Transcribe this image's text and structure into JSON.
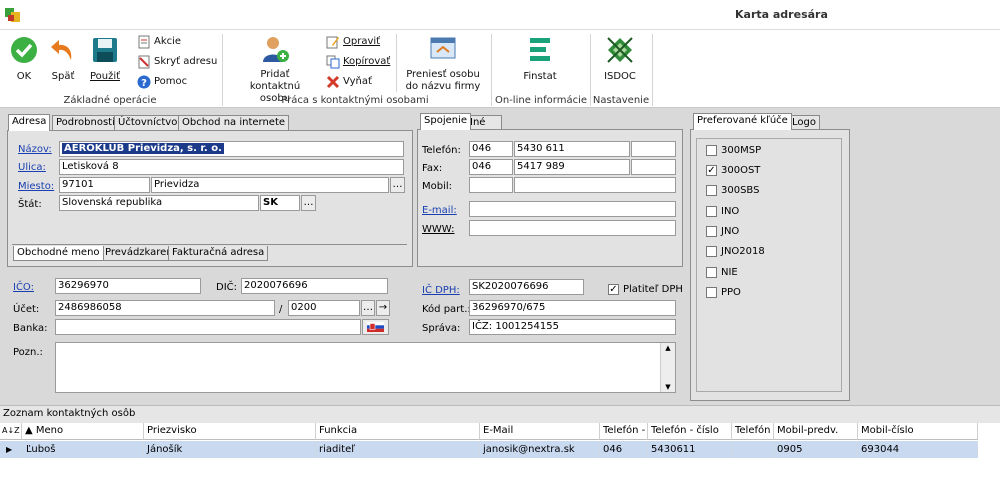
{
  "window": {
    "title": "Karta adresára"
  },
  "ribbon": {
    "ok": "OK",
    "back": "Späť",
    "use": "Použiť",
    "akcie": "Akcie",
    "skryt": "Skryť adresu",
    "pomoc": "Pomoc",
    "group_basic": "Základné operácie",
    "add_contact": "Pridať kontaktnú osobu",
    "opravit": "Opraviť",
    "kopirovat": "Kopírovať",
    "vynat": "Vyňať",
    "group_contacts": "Práca s kontaktnými osobami",
    "preniest": "Preniesť osobu do názvu firmy",
    "finstat": "Finstat",
    "group_online": "On-line informácie",
    "isdoc": "ISDOC",
    "group_settings": "Nastavenie"
  },
  "tabs_main": [
    "Adresa",
    "Podrobnosti",
    "Účtovníctvo",
    "Obchod na internete"
  ],
  "tabs_contact": [
    "Spojenie",
    "Iné"
  ],
  "tabs_right": [
    "Preferované kľúče",
    "Logo"
  ],
  "address": {
    "nazov_label": "Názov:",
    "nazov": "AEROKLUB Prievidza, s. r. o.",
    "ulica_label": "Ulica:",
    "ulica": "Letisková 8",
    "miesto_label": "Miesto:",
    "psc": "97101",
    "mesto": "Prievidza",
    "stat_label": "Štát:",
    "stat": "Slovenská republika",
    "stat_kod": "SK",
    "subtabs": [
      "Obchodné meno",
      "Prevádzkareň",
      "Fakturačná adresa"
    ]
  },
  "contact": {
    "telefon_label": "Telefón:",
    "tel_pred": "046",
    "tel_cislo": "5430 611",
    "fax_label": "Fax:",
    "fax_pred": "046",
    "fax_cislo": "5417 989",
    "mobil_label": "Mobil:",
    "email_label": "E-mail:",
    "www_label": "WWW:"
  },
  "ids": {
    "ico_label": "IČO:",
    "ico": "36296970",
    "dic_label": "DIČ:",
    "dic": "2020076696",
    "icdph_label": "IČ DPH:",
    "icdph": "SK2020076696",
    "platitel_label": "Platiteľ DPH",
    "ucet_label": "Účet:",
    "ucet": "2486986058",
    "slash": "/",
    "kod_banky": "0200",
    "kodpart_label": "Kód part.:",
    "kodpart": "36296970/675",
    "banka_label": "Banka:",
    "sprava_label": "Správa:",
    "sprava": "IČZ: 1001254155",
    "pozn_label": "Pozn.:"
  },
  "keys": [
    {
      "label": "300MSP",
      "checked": false
    },
    {
      "label": "300OST",
      "checked": true
    },
    {
      "label": "300SBS",
      "checked": false
    },
    {
      "label": "INO",
      "checked": false
    },
    {
      "label": "JNO",
      "checked": false
    },
    {
      "label": "JNO2018",
      "checked": false
    },
    {
      "label": "NIE",
      "checked": false
    },
    {
      "label": "PPO",
      "checked": false
    }
  ],
  "contacts_list": {
    "title": "Zoznam kontaktných osôb",
    "sort_label": "A↓Z",
    "headers": [
      "Meno",
      "Priezvisko",
      "Funkcia",
      "E-Mail",
      "Telefón - p",
      "Telefón - číslo",
      "Telefón -",
      "Mobil-predv.",
      "Mobil-číslo"
    ],
    "rows": [
      [
        "Ľuboš",
        "Jánošík",
        "riaditeľ",
        "janosik@nextra.sk",
        "046",
        "5430611",
        "",
        "0905",
        "693044"
      ]
    ]
  },
  "colors": {
    "accent": "#1a3fb0",
    "selected_row": "#c9d9f0"
  }
}
